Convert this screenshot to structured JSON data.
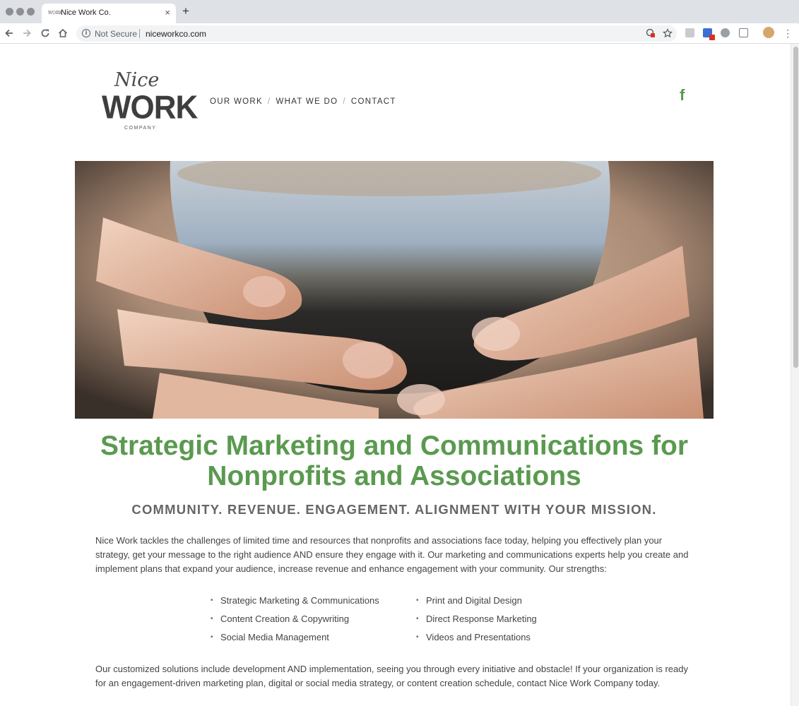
{
  "browser": {
    "tab_title": "Nice Work Co.",
    "tab_favicon": "WORK",
    "tab_close": "×",
    "new_tab": "+",
    "security_label": "Not Secure",
    "url": "niceworkco.com"
  },
  "site": {
    "logo": {
      "script": "Nice",
      "word": "WORK",
      "company": "COMPANY"
    },
    "nav": [
      {
        "label": "OUR WORK"
      },
      {
        "label": "WHAT WE DO"
      },
      {
        "label": "CONTACT"
      }
    ],
    "nav_separator": "/",
    "facebook_glyph": "f"
  },
  "main": {
    "headline": "Strategic Marketing and Communications for Nonprofits and Associations",
    "subhead": "COMMUNITY. REVENUE. ENGAGEMENT. ALIGNMENT WITH YOUR MISSION.",
    "intro": "Nice Work tackles the challenges of limited time and resources that nonprofits and associations face today, helping you effectively plan your strategy, get your message to the right audience AND ensure they engage with it. Our marketing and communications experts help you create and implement plans that expand your audience, increase revenue and enhance engagement with your community. Our strengths:",
    "strengths_left": [
      "Strategic Marketing & Communications",
      "Content Creation & Copywriting",
      "Social Media Management"
    ],
    "strengths_right": [
      "Print and Digital Design",
      "Direct Response Marketing",
      "Videos and Presentations"
    ],
    "outro": "Our customized solutions include development AND implementation, seeing you through every initiative and obstacle! If your organization is ready for an engagement-driven marketing plan, digital or social media strategy, or content creation schedule, contact Nice Work Company today."
  },
  "colors": {
    "brand_green": "#5a9a4f",
    "text": "#444444",
    "chrome": "#dee1e6"
  },
  "icons": {
    "back": "arrow-left-icon",
    "forward": "arrow-right-icon",
    "reload": "reload-icon",
    "home": "home-icon",
    "info": "info-icon",
    "star": "star-icon",
    "menu": "kebab-menu-icon",
    "social": "facebook-icon"
  }
}
